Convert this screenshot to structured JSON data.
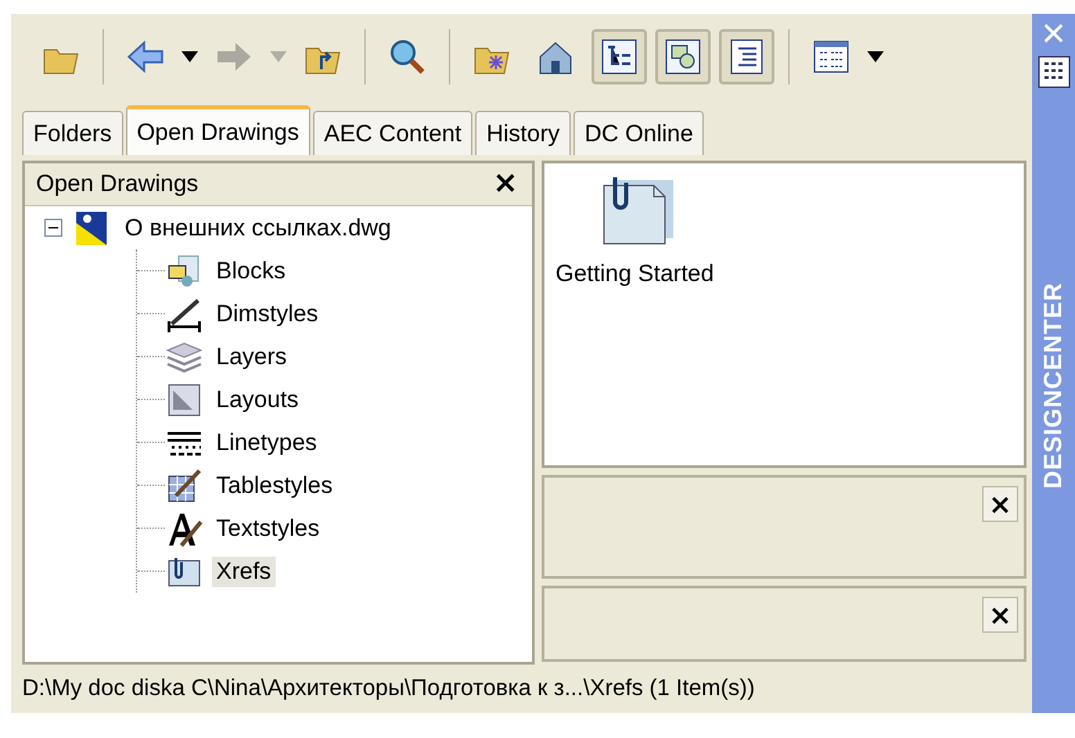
{
  "toolbar": [
    {
      "kind": "load"
    },
    {
      "kind": "sep"
    },
    {
      "kind": "back",
      "dropdown": true,
      "disabled": false
    },
    {
      "kind": "forward",
      "dropdown": true,
      "disabled": true
    },
    {
      "kind": "up"
    },
    {
      "kind": "sep"
    },
    {
      "kind": "search"
    },
    {
      "kind": "sep"
    },
    {
      "kind": "favorites"
    },
    {
      "kind": "home"
    },
    {
      "kind": "tree",
      "pressed": true
    },
    {
      "kind": "preview",
      "pressed": true
    },
    {
      "kind": "description",
      "pressed": true
    },
    {
      "kind": "sep"
    },
    {
      "kind": "views",
      "dropdown": true
    }
  ],
  "tabs": [
    {
      "label": "Folders",
      "selected": false
    },
    {
      "label": "Open Drawings",
      "selected": true
    },
    {
      "label": "AEC Content",
      "selected": false
    },
    {
      "label": "History",
      "selected": false
    },
    {
      "label": "DC Online",
      "selected": false
    }
  ],
  "tree_panel": {
    "title": "Open Drawings",
    "close": "×",
    "root": {
      "label": "О внешних ссылках.dwg",
      "expanded": true,
      "children": [
        {
          "label": "Blocks",
          "kind": "blocks",
          "selected": false
        },
        {
          "label": "Dimstyles",
          "kind": "dimstyles",
          "selected": false
        },
        {
          "label": "Layers",
          "kind": "layers",
          "selected": false
        },
        {
          "label": "Layouts",
          "kind": "layouts",
          "selected": false
        },
        {
          "label": "Linetypes",
          "kind": "linetypes",
          "selected": false
        },
        {
          "label": "Tablestyles",
          "kind": "tablestyles",
          "selected": false
        },
        {
          "label": "Textstyles",
          "kind": "textstyles",
          "selected": false
        },
        {
          "label": "Xrefs",
          "kind": "xrefs",
          "selected": true
        }
      ]
    }
  },
  "content": {
    "items": [
      {
        "label": "Getting Started"
      }
    ]
  },
  "preview_panel": {
    "close": "×"
  },
  "description_panel": {
    "close": "×"
  },
  "status_bar": "D:\\My doc diska C\\Nina\\Архитекторы\\Подготовка к з...\\Xrefs (1 Item(s))",
  "side_bar": {
    "close": "×",
    "title": "DESIGNCENTER"
  }
}
